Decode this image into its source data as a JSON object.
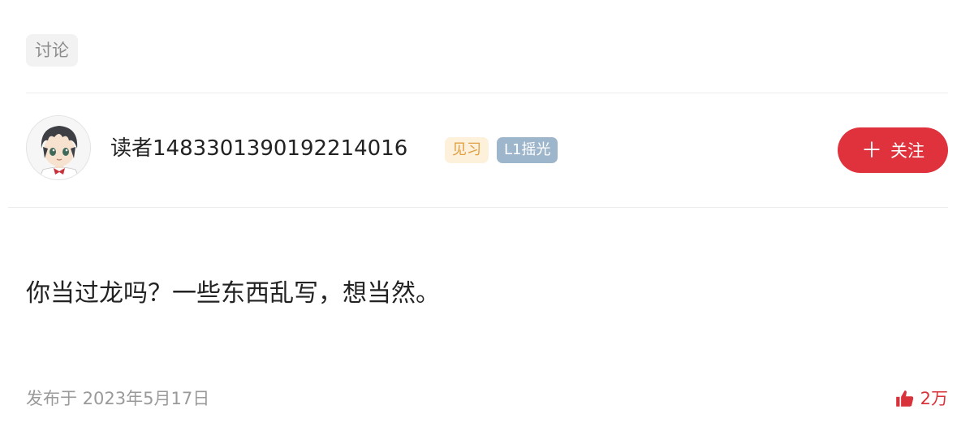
{
  "tag": {
    "label": "讨论"
  },
  "author": {
    "username": "读者1483301390192214016",
    "rank_badge": "见习",
    "level_badge": "L1摇光",
    "avatar_icon": "anime-boy-avatar"
  },
  "follow": {
    "label": "关注",
    "icon": "plus-icon",
    "color": "#e0323c"
  },
  "comment": {
    "text": "你当过龙吗？一些东西乱写，想当然。"
  },
  "meta": {
    "published": "发布于 2023年5月17日",
    "likes": "2万",
    "like_icon": "thumbs-up-icon",
    "like_color": "#d8323a"
  }
}
